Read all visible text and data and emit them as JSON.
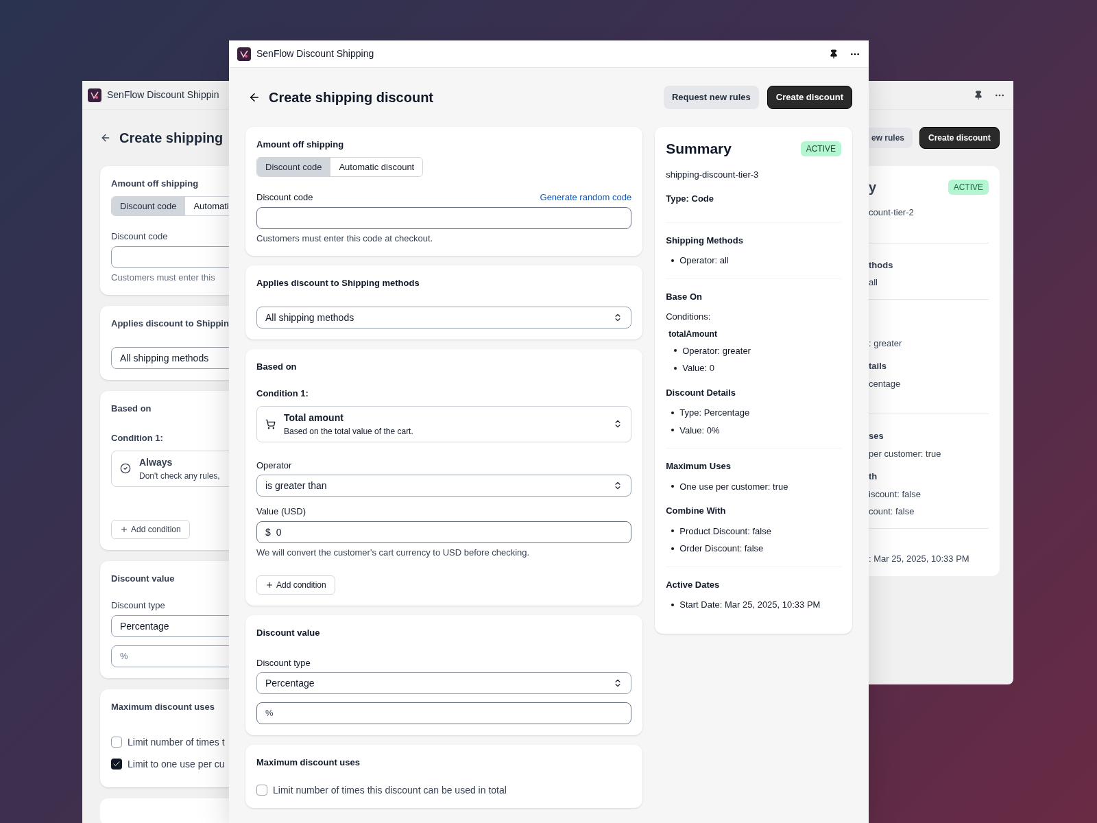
{
  "back_window_left": {
    "title": "SenFlow Discount Shippin",
    "page_title": "Create shipping",
    "amount_off_shipping": {
      "heading": "Amount off shipping",
      "tabs": [
        {
          "label": "Discount code",
          "selected": true
        },
        {
          "label": "Automati",
          "selected": false
        }
      ],
      "field_label": "Discount code",
      "help": "Customers must enter this"
    },
    "shipping_methods": {
      "heading": "Applies discount to Shippin",
      "select": "All shipping methods"
    },
    "based_on": {
      "heading": "Based on",
      "condition_label": "Condition 1:",
      "condition": {
        "title": "Always",
        "description": "Don't check any rules,"
      },
      "add_button": "Add condition"
    },
    "discount_value": {
      "heading": "Discount value",
      "type_label": "Discount type",
      "type": "Percentage",
      "amount_prefix": "%"
    },
    "maximum_uses": {
      "heading": "Maximum discount uses",
      "options": [
        {
          "label": "Limit number of times t",
          "checked": false
        },
        {
          "label": "Limit to one use per cu",
          "checked": true
        }
      ]
    }
  },
  "back_window_right": {
    "buttons": [
      {
        "label": "ew rules",
        "kind": "secondary"
      },
      {
        "label": "Create discount",
        "kind": "primary"
      }
    ],
    "summary_title": "y",
    "status": "ACTIVE",
    "lines": [
      {
        "kind": "text",
        "text": "count-tier-2"
      },
      {
        "kind": "gap"
      },
      {
        "kind": "divider"
      },
      {
        "kind": "heading",
        "text": "thods"
      },
      {
        "kind": "text",
        "text": "all"
      },
      {
        "kind": "divider"
      },
      {
        "kind": "gap"
      },
      {
        "kind": "gap"
      },
      {
        "kind": "text",
        "text": ": greater"
      },
      {
        "kind": "heading",
        "text": "tails"
      },
      {
        "kind": "text",
        "text": "centage"
      },
      {
        "kind": "gap"
      },
      {
        "kind": "divider"
      },
      {
        "kind": "heading",
        "text": "ses"
      },
      {
        "kind": "text",
        "text": "per customer: true"
      },
      {
        "kind": "heading",
        "text": "th"
      },
      {
        "kind": "text",
        "text": "iscount: false"
      },
      {
        "kind": "text",
        "text": "count: false"
      },
      {
        "kind": "divider"
      },
      {
        "kind": "gap"
      },
      {
        "kind": "text",
        "text": ": Mar 25, 2025, 10:33 PM"
      }
    ]
  },
  "front_window": {
    "title": "SenFlow Discount Shipping",
    "page_title": "Create shipping discount",
    "buttons": [
      {
        "label": "Request new rules",
        "kind": "secondary"
      },
      {
        "label": "Create discount",
        "kind": "primary"
      }
    ],
    "amount_off_shipping": {
      "heading": "Amount off shipping",
      "tabs": [
        {
          "label": "Discount code",
          "selected": true
        },
        {
          "label": "Automatic discount",
          "selected": false
        }
      ],
      "field_label": "Discount code",
      "link": "Generate random code",
      "help": "Customers must enter this code at checkout."
    },
    "shipping_methods": {
      "heading": "Applies discount to Shipping methods",
      "select": "All shipping methods"
    },
    "based_on": {
      "heading": "Based on",
      "condition_label": "Condition 1:",
      "condition": {
        "title": "Total amount",
        "description": "Based on the total value of the cart."
      },
      "operator_label": "Operator",
      "operator": "is greater than",
      "value_label": "Value (USD)",
      "value_prefix": "$",
      "value": "0",
      "help": "We will convert the customer's cart currency to USD before checking.",
      "add_button": "Add condition"
    },
    "discount_value": {
      "heading": "Discount value",
      "type_label": "Discount type",
      "type": "Percentage",
      "amount_prefix": "%"
    },
    "maximum_uses": {
      "heading": "Maximum discount uses",
      "options": [
        {
          "label": "Limit number of times this discount can be used in total",
          "checked": false
        }
      ]
    },
    "summary": {
      "title": "Summary",
      "status": "ACTIVE",
      "code": "shipping-discount-tier-3",
      "type_line": "Type: Code",
      "groups": [
        [
          {
            "heading": "Shipping Methods",
            "lines": [
              {
                "kind": "bullet",
                "text": "Operator: all"
              }
            ]
          }
        ],
        [
          {
            "heading": "Base On",
            "lines": [
              {
                "kind": "text",
                "text": "Conditions:"
              },
              {
                "kind": "subheading",
                "text": "totalAmount"
              },
              {
                "kind": "sub_bullet",
                "text": "Operator: greater"
              },
              {
                "kind": "sub_bullet",
                "text": "Value: 0"
              }
            ]
          },
          {
            "heading": "Discount Details",
            "lines": [
              {
                "kind": "bullet",
                "text": "Type: Percentage"
              },
              {
                "kind": "bullet",
                "text": "Value: 0%"
              }
            ]
          }
        ],
        [
          {
            "heading": "Maximum Uses",
            "lines": [
              {
                "kind": "bullet",
                "text": "One use per customer: true"
              }
            ]
          },
          {
            "heading": "Combine With",
            "lines": [
              {
                "kind": "bullet",
                "text": "Product Discount: false"
              },
              {
                "kind": "bullet",
                "text": "Order Discount: false"
              }
            ]
          }
        ],
        [
          {
            "heading": "Active Dates",
            "lines": [
              {
                "kind": "bullet",
                "text": "Start Date: Mar 25, 2025, 10:33 PM"
              }
            ]
          }
        ]
      ]
    }
  }
}
